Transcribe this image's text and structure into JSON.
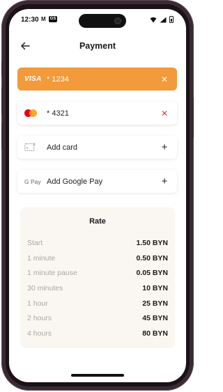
{
  "status": {
    "time": "12:30",
    "left_icons": [
      "M",
      "GS"
    ]
  },
  "header": {
    "title": "Payment",
    "back_icon": "arrow-left-icon"
  },
  "payment_methods": [
    {
      "brand": "VISA",
      "label": "* 1234",
      "selected": true,
      "action": "remove"
    },
    {
      "brand": "mastercard",
      "label": "* 4321",
      "selected": false,
      "action": "remove"
    },
    {
      "brand": "card-add",
      "label": "Add card",
      "action": "add"
    },
    {
      "brand": "G Pay",
      "label": "Add Google Pay",
      "action": "add"
    }
  ],
  "rate": {
    "title": "Rate",
    "rows": [
      {
        "label": "Start",
        "value": "1.50 BYN"
      },
      {
        "label": "1 minute",
        "value": "0.50 BYN"
      },
      {
        "label": "1 minute pause",
        "value": "0.05 BYN"
      },
      {
        "label": "30 minutes",
        "value": "10 BYN"
      },
      {
        "label": "1 hour",
        "value": "25 BYN"
      },
      {
        "label": "2 hours",
        "value": "45 BYN"
      },
      {
        "label": "4 hours",
        "value": "80 BYN"
      }
    ]
  },
  "colors": {
    "accent": "#f39a3b",
    "remove_red": "#e53935",
    "frame": "#3a2a33"
  }
}
